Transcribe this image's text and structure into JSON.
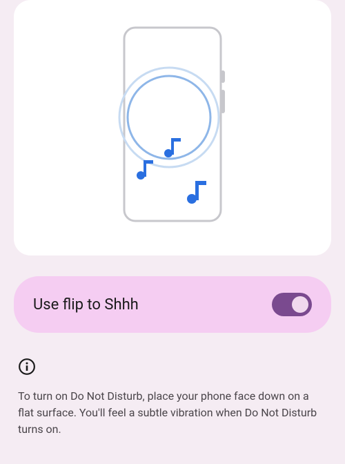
{
  "toggle": {
    "label": "Use flip to Shhh",
    "enabled": true
  },
  "info": {
    "text": "To turn on Do Not Disturb, place your phone face down on a flat surface. You'll feel a subtle vibration when Do Not Disturb turns on."
  },
  "colors": {
    "background": "#f5ecf3",
    "card": "#ffffff",
    "toggleRow": "#f5cdf2",
    "switchTrack": "#7a4a8f",
    "switchThumb": "#f0d9ee",
    "phoneOutline": "#c7c7cc",
    "ringLight": "#bcd4f0",
    "ringMedium": "#8eb6e8",
    "noteColor": "#2a6fe0",
    "infoText": "#4a454a"
  }
}
